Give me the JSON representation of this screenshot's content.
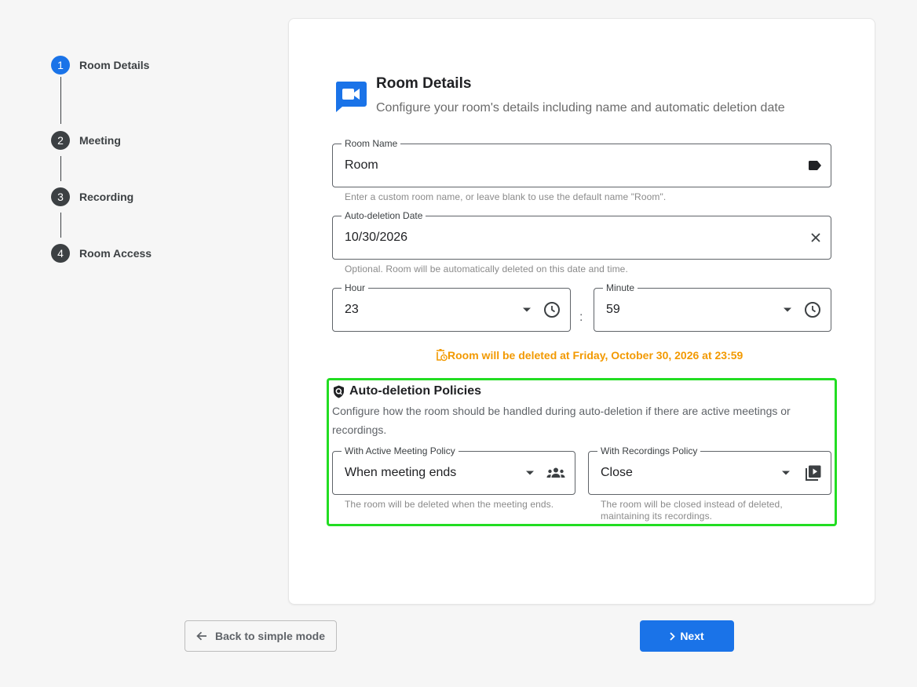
{
  "stepper": {
    "steps": [
      {
        "num": "1",
        "label": "Room Details"
      },
      {
        "num": "2",
        "label": "Meeting"
      },
      {
        "num": "3",
        "label": "Recording"
      },
      {
        "num": "4",
        "label": "Room Access"
      }
    ],
    "active_step": 1
  },
  "header": {
    "title": "Room Details",
    "subtitle": "Configure your room's details including name and automatic deletion date"
  },
  "room_name": {
    "label": "Room Name",
    "value": "Room",
    "hint": "Enter a custom room name, or leave blank to use the default name \"Room\"."
  },
  "auto_deletion_date": {
    "label": "Auto-deletion Date",
    "value": "10/30/2026",
    "hint": "Optional. Room will be automatically deleted on this date and time."
  },
  "hour": {
    "label": "Hour",
    "value": "23"
  },
  "time_separator": ":",
  "minute": {
    "label": "Minute",
    "value": "59"
  },
  "deletion_note": "Room will be deleted at Friday, October 30, 2026 at 23:59",
  "policies": {
    "title": "Auto-deletion Policies",
    "description": "Configure how the room should be handled during auto-deletion if there are active meetings or recordings.",
    "meeting_policy": {
      "label": "With Active Meeting Policy",
      "value": "When meeting ends",
      "hint": "The room will be deleted when the meeting ends."
    },
    "recordings_policy": {
      "label": "With Recordings Policy",
      "value": "Close",
      "hint": "The room will be closed instead of deleted, maintaining its recordings."
    }
  },
  "buttons": {
    "back": "Back to simple mode",
    "next": "Next"
  },
  "colors": {
    "primary": "#1a73e8",
    "warning": "#f29900",
    "highlight": "#22dd22"
  }
}
